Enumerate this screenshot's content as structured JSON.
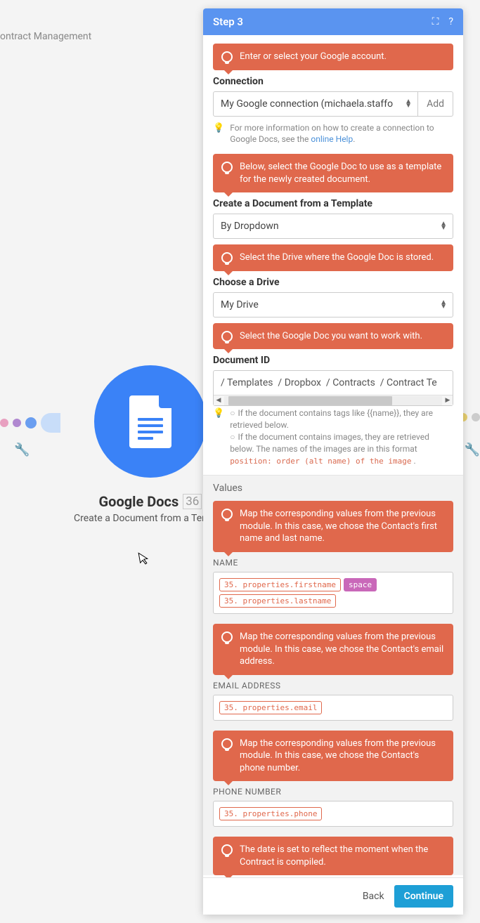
{
  "bg": {
    "title": "ontract Management"
  },
  "node": {
    "title": "Google Docs",
    "num": "36",
    "sub": "Create a Document from a Templat"
  },
  "panel": {
    "header": {
      "title": "Step 3"
    },
    "footer": {
      "back": "Back",
      "continue": "Continue"
    },
    "callouts": {
      "c1": "Enter or select your Google account.",
      "c2": "Below, select the Google Doc to use as a template for the newly created document.",
      "c3": "Select the Drive where the Google Doc is stored.",
      "c4": "Select the Google Doc you want to work with.",
      "c5": "Map the corresponding values from the previous module. In this case, we chose the Contact's first name and last name.",
      "c6": "Map the corresponding values from the previous module. In this case, we chose the Contact's email address.",
      "c7": "Map the corresponding values from the previous module. In this case, we chose the Contact's phone number.",
      "c8": "The date is set to reflect the moment when the Contract is compiled."
    },
    "labels": {
      "connection": "Connection",
      "create": "Create a Document from a Template",
      "drive": "Choose a Drive",
      "docid": "Document ID",
      "values": "Values",
      "name": "NAME",
      "email": "EMAIL ADDRESS",
      "phone": "PHONE NUMBER"
    },
    "fields": {
      "connection": "My Google connection (michaela.staffo",
      "add": "Add",
      "create": "By Dropdown",
      "drive": "My Drive",
      "path": [
        "Templates",
        "Dropbox",
        "Contracts",
        "Contract Te"
      ]
    },
    "hints": {
      "conn_pre": "For more information on how to create a connection to Google Docs, see the ",
      "conn_link": "online Help",
      "conn_post": ".",
      "doc1": "If the document contains tags like {{name}}, they are retrieved below.",
      "doc2a": "If the document contains images, they are retrieved below. The names of the images are in this format ",
      "doc2b": "position: order (alt name) of the image",
      "doc2c": " ."
    },
    "pills": {
      "firstname": "35. properties.firstname",
      "space": "space",
      "lastname": "35. properties.lastname",
      "email": "35. properties.email",
      "phone": "35. properties.phone"
    }
  }
}
